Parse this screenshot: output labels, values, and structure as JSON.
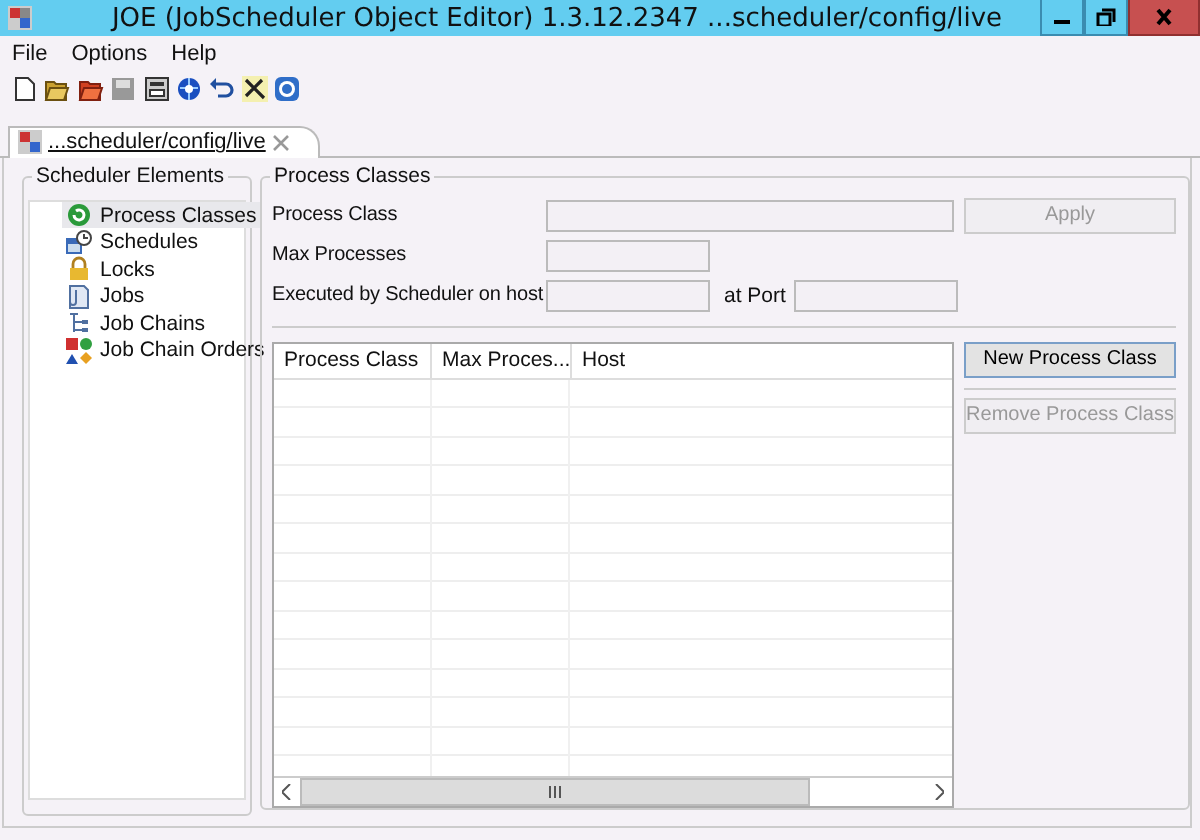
{
  "window": {
    "title": "JOE (JobScheduler Object Editor) 1.3.12.2347 ...scheduler/config/live"
  },
  "menu": [
    "File",
    "Options",
    "Help"
  ],
  "tabs": [
    {
      "label": "...scheduler/config/live",
      "selected": true
    }
  ],
  "sidebar": {
    "title": "Scheduler Elements",
    "items": [
      {
        "label": "Process Classes",
        "kind": "process",
        "selected": true
      },
      {
        "label": "Schedules",
        "kind": "schedule",
        "selected": false
      },
      {
        "label": "Locks",
        "kind": "lock",
        "selected": false
      },
      {
        "label": "Jobs",
        "kind": "job",
        "selected": false
      },
      {
        "label": "Job Chains",
        "kind": "chain",
        "selected": false
      },
      {
        "label": "Job Chain Orders",
        "kind": "order",
        "selected": false
      }
    ]
  },
  "form": {
    "title": "Process Classes",
    "process_class": {
      "label": "Process Class"
    },
    "apply_button": {
      "label": "Apply",
      "disabled": true
    },
    "max_processes": {
      "label": "Max Processes"
    },
    "host": {
      "label": "Executed by Scheduler on host"
    },
    "port": {
      "label": "at Port"
    }
  },
  "table": {
    "columns": [
      "Process Class",
      "Max Proces...",
      "Host"
    ]
  },
  "buttons": [
    {
      "label": "New Process Class",
      "disabled": false
    },
    {
      "label": "Remove Process Class",
      "disabled": true
    }
  ]
}
